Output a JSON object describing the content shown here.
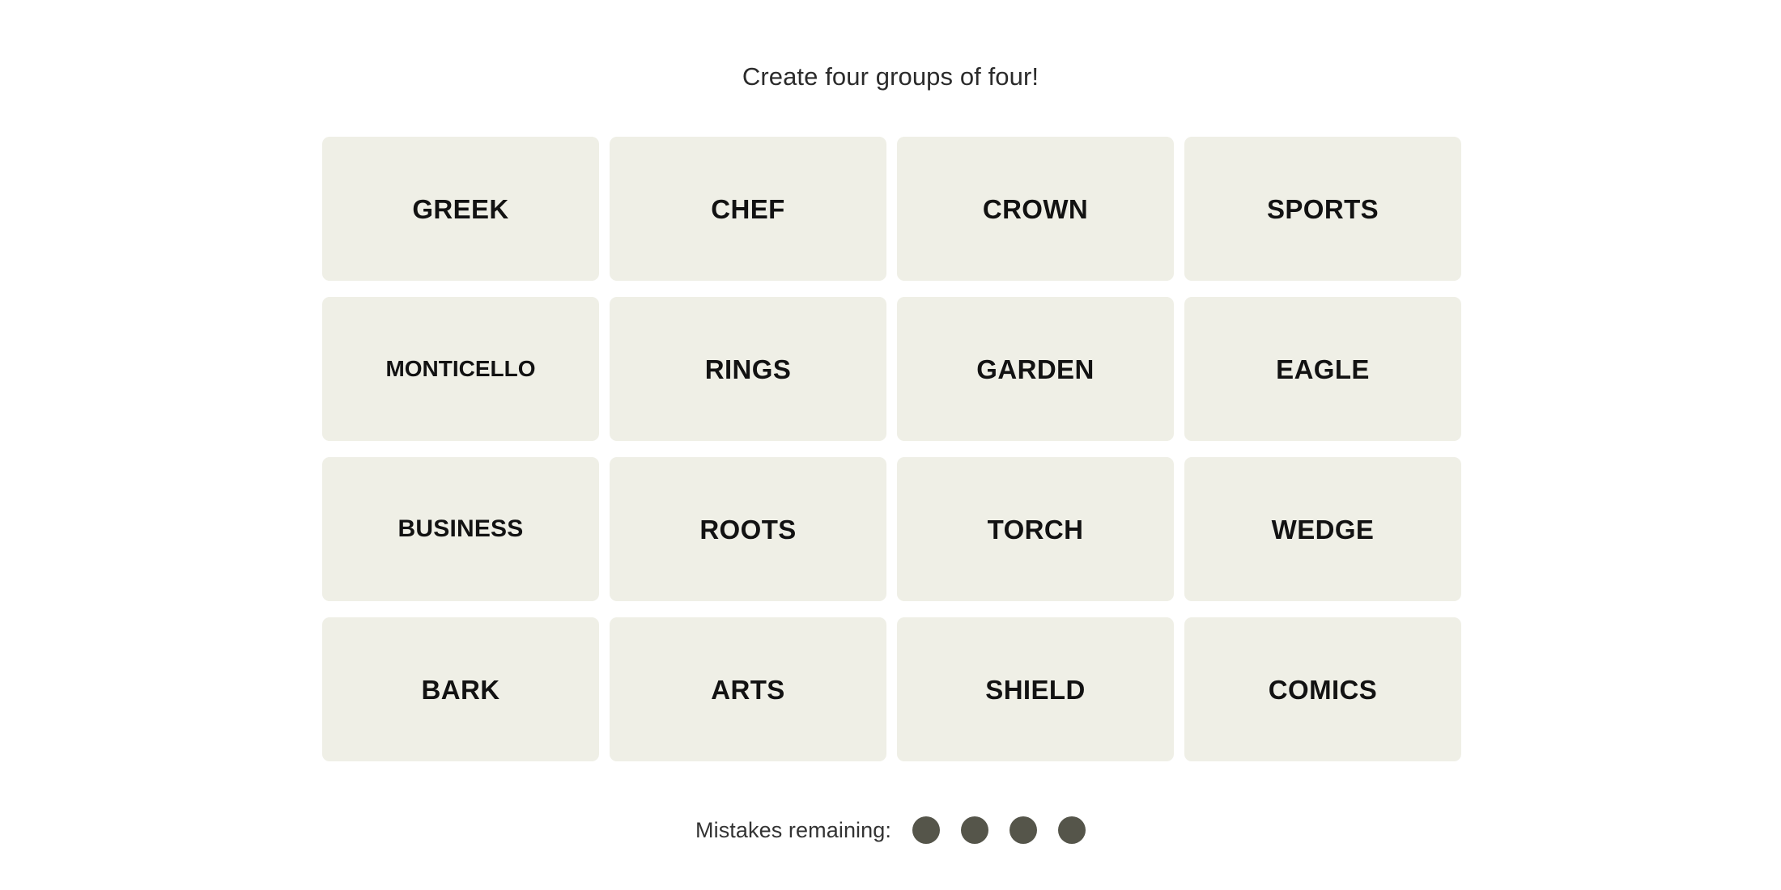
{
  "page": {
    "background_color": "#ffffff",
    "title": "Create four groups of four!"
  },
  "board": {
    "tile_color": "#efefe6",
    "tile_text_color": "#121212",
    "rows": [
      {
        "tiles": [
          {
            "word": "GREEK"
          },
          {
            "word": "CHEF"
          },
          {
            "word": "CROWN"
          },
          {
            "word": "SPORTS"
          }
        ]
      },
      {
        "tiles": [
          {
            "word": "MONTICELLO"
          },
          {
            "word": "RINGS"
          },
          {
            "word": "GARDEN"
          },
          {
            "word": "EAGLE"
          }
        ]
      },
      {
        "tiles": [
          {
            "word": "BUSINESS"
          },
          {
            "word": "ROOTS"
          },
          {
            "word": "TORCH"
          },
          {
            "word": "WEDGE"
          }
        ]
      },
      {
        "tiles": [
          {
            "word": "BARK"
          },
          {
            "word": "ARTS"
          },
          {
            "word": "SHIELD"
          },
          {
            "word": "COMICS"
          }
        ]
      }
    ]
  },
  "footer": {
    "mistakes_label": "Mistakes remaining:",
    "mistakes_count": 4,
    "dot_color": "#55554a",
    "dot_icon_name": "mistake-dot-icon"
  }
}
